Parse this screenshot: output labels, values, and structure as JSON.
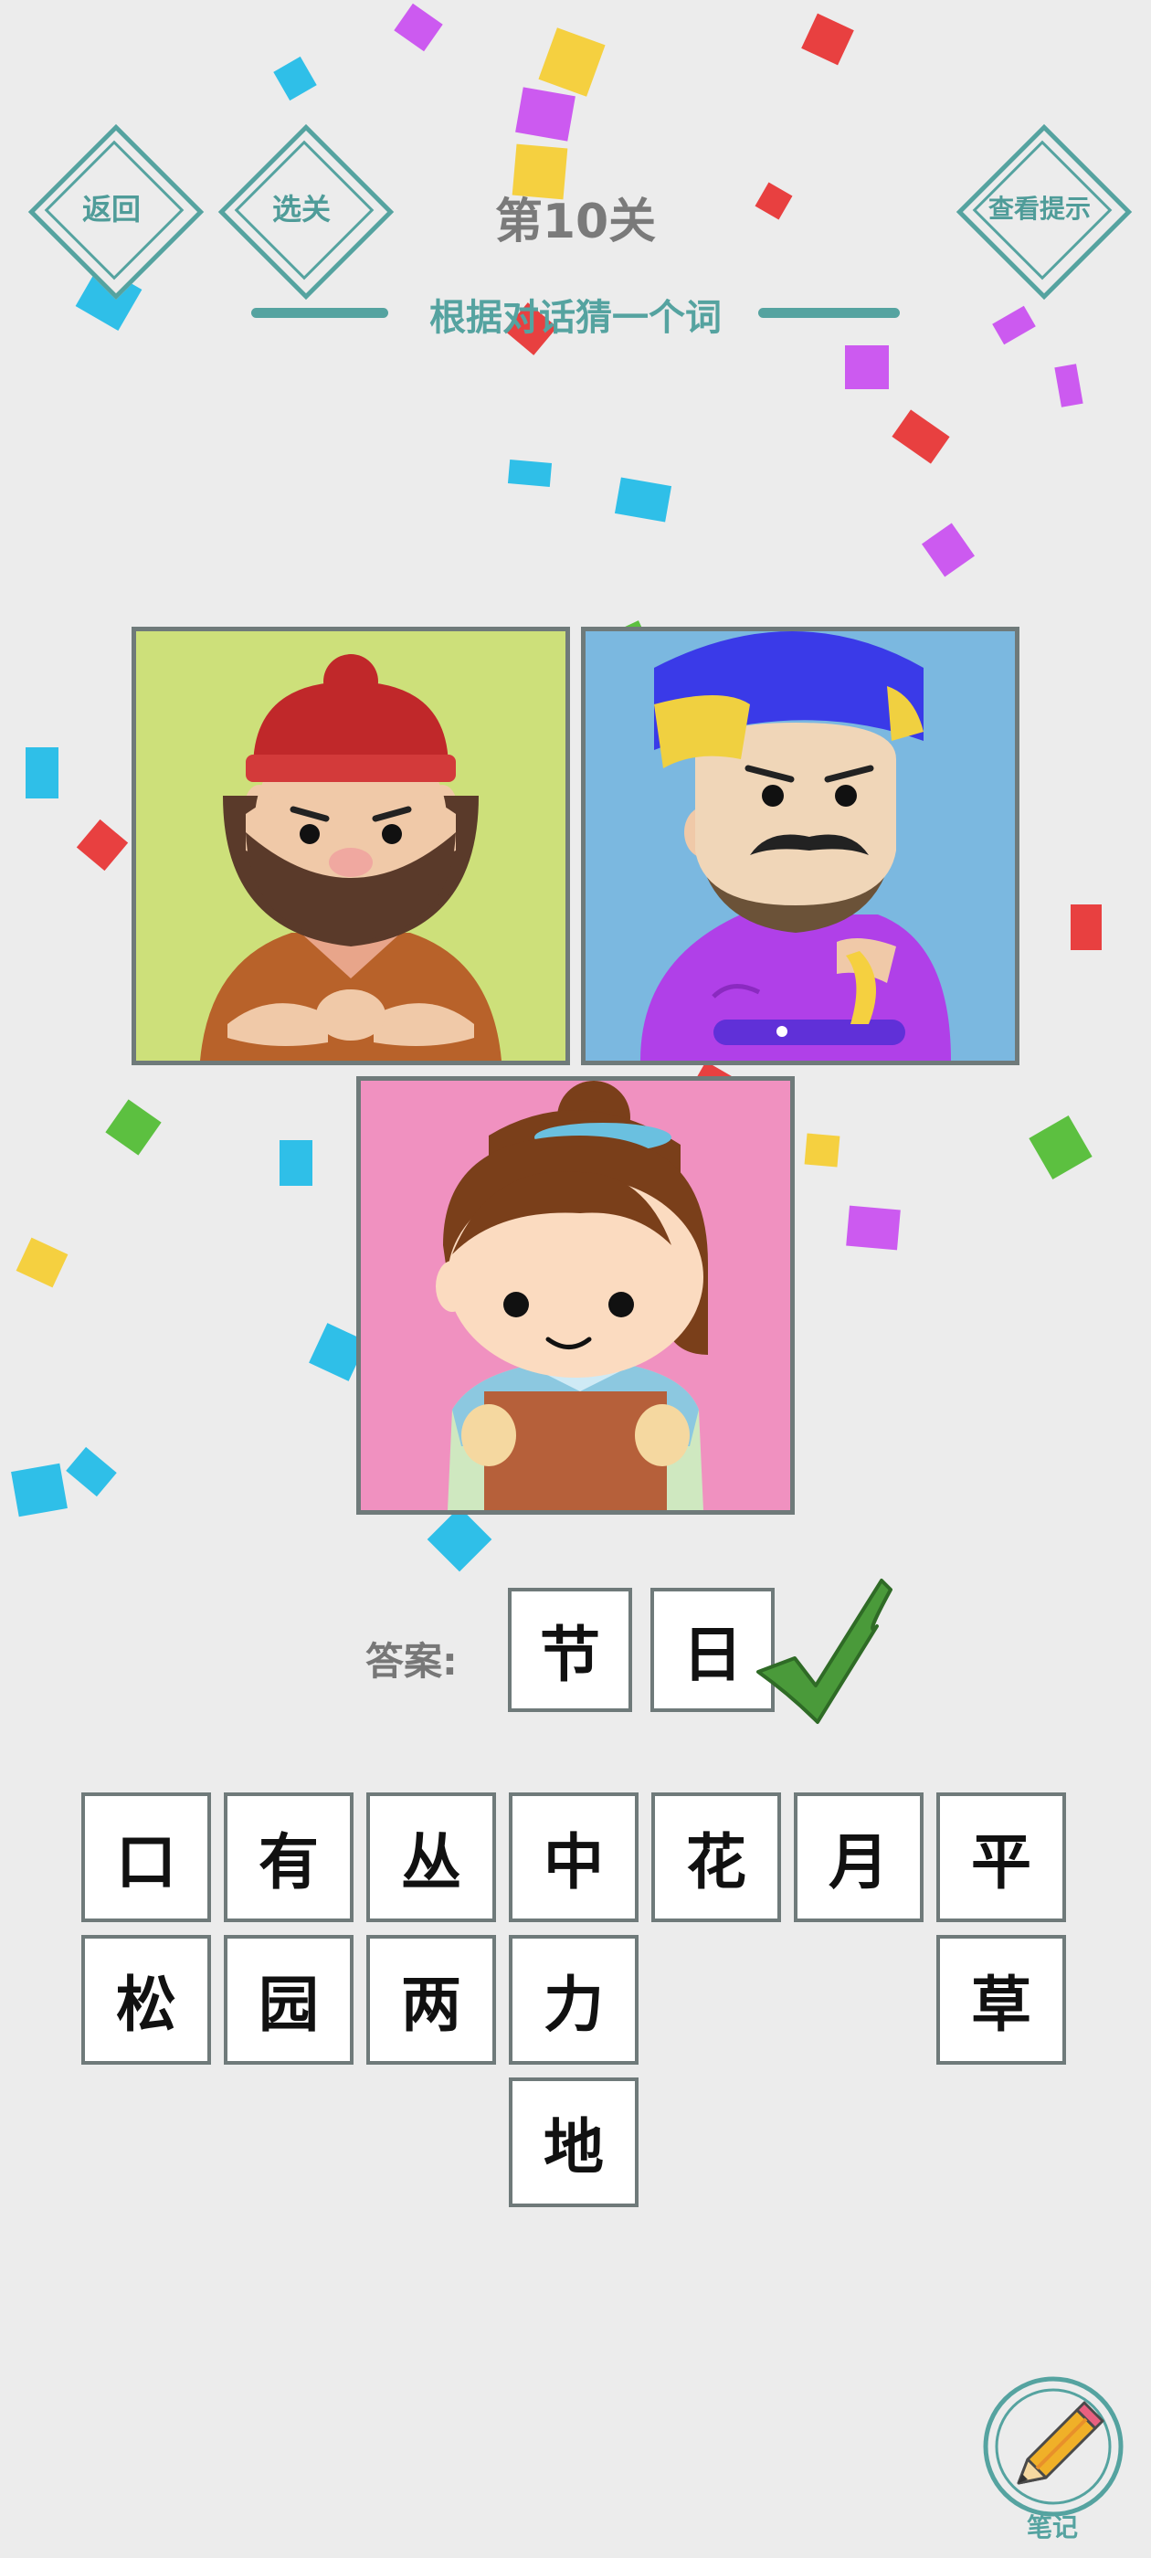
{
  "header": {
    "back_label": "返回",
    "select_level_label": "选关",
    "hint_label": "查看提示",
    "level_title": "第10关",
    "subtitle": "根据对话猜一个词"
  },
  "puzzle": {
    "panels": [
      "red-hat-bearded-man",
      "blue-hat-mustache-man",
      "reading-boy"
    ]
  },
  "answer": {
    "label": "答案:",
    "chars": [
      "节",
      "日"
    ],
    "status": "correct"
  },
  "tiles": {
    "row1": [
      "口",
      "有",
      "丛",
      "中",
      "花",
      "月",
      "平"
    ],
    "row2": [
      "松",
      "园",
      "两",
      "力",
      "草"
    ],
    "row3": [
      "地"
    ]
  },
  "footer": {
    "notes_label": "笔记"
  },
  "colors": {
    "accent": "#55a3a0",
    "background": "#ececec",
    "check": "#4a9a3a"
  }
}
